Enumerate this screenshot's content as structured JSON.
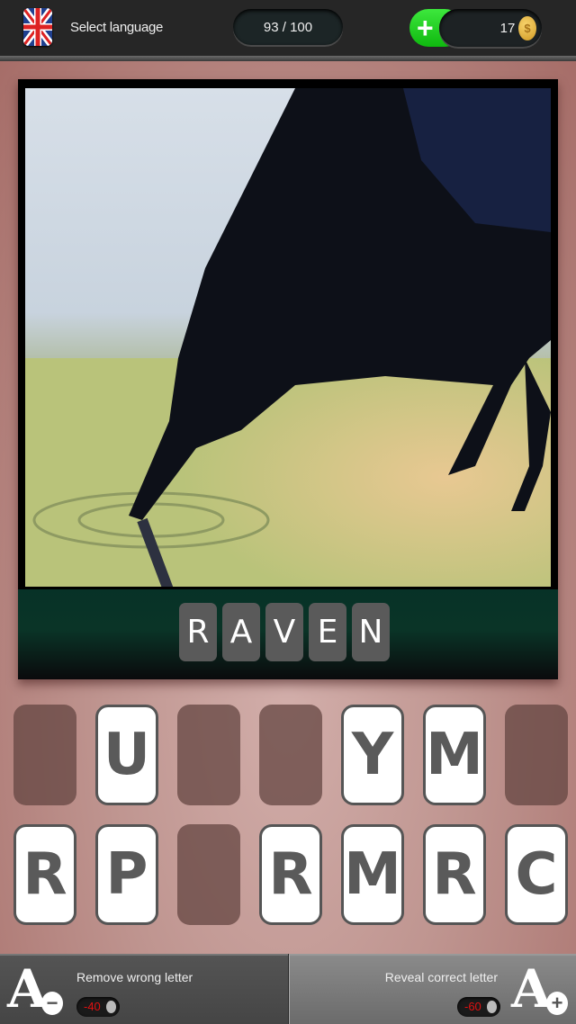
{
  "header": {
    "language_icon": "uk-flag-icon",
    "language_label": "Select language",
    "progress": "93 / 100",
    "coins": "17",
    "add_coins_icon": "plus-icon",
    "coin_icon": "coin-icon",
    "coin_symbol": "$"
  },
  "puzzle": {
    "image_subject": "raven drinking water",
    "answer_letters": [
      "R",
      "A",
      "V",
      "E",
      "N"
    ]
  },
  "letter_pool": {
    "row1": [
      "",
      "U",
      "",
      "",
      "Y",
      "M",
      ""
    ],
    "row2": [
      "R",
      "P",
      "",
      "R",
      "M",
      "R",
      "C"
    ]
  },
  "hints": {
    "remove": {
      "label": "Remove wrong letter",
      "cost": "-40",
      "icon": "remove-letter-icon",
      "glyph": "A",
      "badge": "−"
    },
    "reveal": {
      "label": "Reveal correct letter",
      "cost": "-60",
      "icon": "reveal-letter-icon",
      "glyph": "A",
      "badge": "+"
    }
  },
  "colors": {
    "coins_green": "#1fcf1f",
    "cost_red": "#e01010",
    "tile_text": "#5a5a5a",
    "answer_band": "#073227"
  }
}
